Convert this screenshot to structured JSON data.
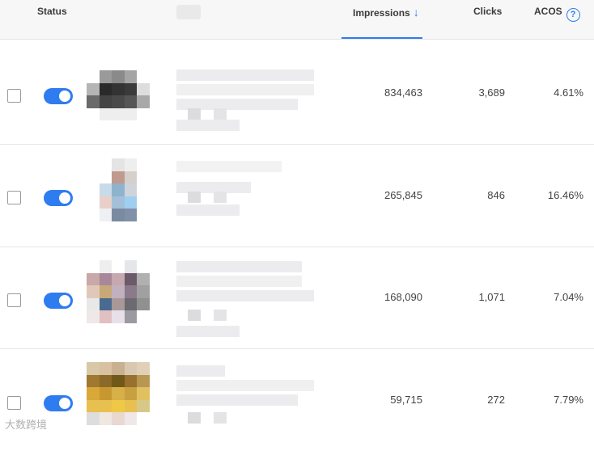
{
  "header": {
    "status": "Status",
    "impressions": "Impressions",
    "clicks": "Clicks",
    "acos": "ACOS",
    "sort_icon": "arrow-down-icon",
    "help_icon": "question-circle-icon"
  },
  "rows": [
    {
      "impressions": "834,463",
      "clicks": "3,689",
      "acos": "4.61%",
      "enabled": true
    },
    {
      "impressions": "265,845",
      "clicks": "846",
      "acos": "16.46%",
      "enabled": true
    },
    {
      "impressions": "168,090",
      "clicks": "1,071",
      "acos": "7.04%",
      "enabled": true
    },
    {
      "impressions": "59,715",
      "clicks": "272",
      "acos": "7.79%",
      "enabled": true
    }
  ],
  "colors": {
    "accent": "#2f7cf0"
  },
  "watermark": "大数跨境"
}
